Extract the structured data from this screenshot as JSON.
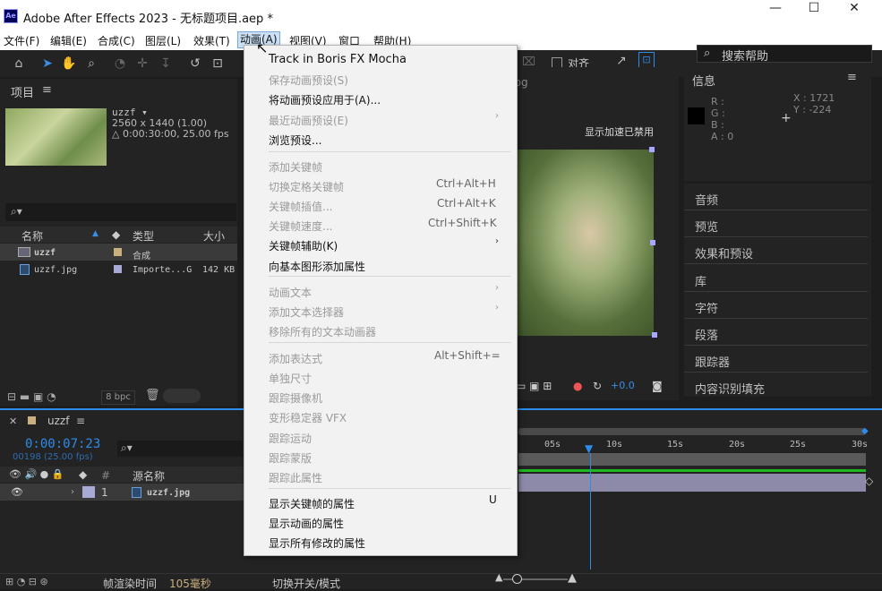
{
  "window": {
    "title": "Adobe After Effects 2023 - 无标题项目.aep *",
    "logo": "Ae",
    "minimize": "—",
    "maximize": "☐",
    "close": "✕"
  },
  "menubar": [
    "文件(F)",
    "编辑(E)",
    "合成(C)",
    "图层(L)",
    "效果(T)",
    "动画(A)",
    "视图(V)",
    "窗口",
    "帮助(H)"
  ],
  "toolbar": {
    "snap_label": "对齐",
    "search_placeholder": "搜索帮助"
  },
  "project_panel": {
    "title": "项目",
    "comp_name": "uzzf ▾",
    "comp_size": "2560 x 1440 (1.00)",
    "comp_duration": "△ 0:00:30:00, 25.00 fps",
    "columns": [
      "名称",
      "类型",
      "大小"
    ],
    "rows": [
      {
        "name": "uzzf",
        "type": "合成",
        "size": ""
      },
      {
        "name": "uzzf.jpg",
        "type": "Importe...G",
        "size": "142 KB"
      }
    ],
    "bpc": "8 bpc"
  },
  "comp_viewer": {
    "footage_label": "jpg",
    "status": "显示加速已禁用",
    "exposure": "+0.0"
  },
  "info_panel": {
    "title": "信息",
    "r": "R :",
    "g": "G :",
    "b": "B :",
    "a": "A : 0",
    "x": "X : 1721",
    "y": "Y : -224"
  },
  "right_panels": [
    "音频",
    "预览",
    "效果和预设",
    "库",
    "字符",
    "段落",
    "跟踪器",
    "内容识别填充"
  ],
  "anim_menu": {
    "items": [
      {
        "label": "Track in Boris FX Mocha",
        "enabled": true
      },
      {
        "label": "保存动画预设(S)",
        "enabled": false
      },
      {
        "label": "将动画预设应用于(A)...",
        "enabled": true
      },
      {
        "label": "最近动画预设(E)",
        "enabled": false,
        "submenu": true
      },
      {
        "label": "浏览预设...",
        "enabled": true
      },
      {
        "label": "添加关键帧",
        "enabled": false
      },
      {
        "label": "切换定格关键帧",
        "enabled": false,
        "shortcut": "Ctrl+Alt+H"
      },
      {
        "label": "关键帧插值...",
        "enabled": false,
        "shortcut": "Ctrl+Alt+K"
      },
      {
        "label": "关键帧速度...",
        "enabled": false,
        "shortcut": "Ctrl+Shift+K"
      },
      {
        "label": "关键帧辅助(K)",
        "enabled": true,
        "submenu": true
      },
      {
        "label": "向基本图形添加属性",
        "enabled": true
      },
      {
        "label": "动画文本",
        "enabled": false,
        "submenu": true
      },
      {
        "label": "添加文本选择器",
        "enabled": false,
        "submenu": true
      },
      {
        "label": "移除所有的文本动画器",
        "enabled": false
      },
      {
        "label": "添加表达式",
        "enabled": false,
        "shortcut": "Alt+Shift+="
      },
      {
        "label": "单独尺寸",
        "enabled": false
      },
      {
        "label": "跟踪摄像机",
        "enabled": false
      },
      {
        "label": "变形稳定器 VFX",
        "enabled": false
      },
      {
        "label": "跟踪运动",
        "enabled": false
      },
      {
        "label": "跟踪蒙版",
        "enabled": false
      },
      {
        "label": "跟踪此属性",
        "enabled": false
      },
      {
        "label": "显示关键帧的属性",
        "enabled": true,
        "shortcut": "U"
      },
      {
        "label": "显示动画的属性",
        "enabled": true
      },
      {
        "label": "显示所有修改的属性",
        "enabled": true
      }
    ]
  },
  "timeline": {
    "comp_tab": "uzzf",
    "timecode": "0:00:07:23",
    "frame_info": "00198 (25.00 fps)",
    "source_col": "源名称",
    "layer_num": "1",
    "layer_name": "uzzf.jpg",
    "ruler": [
      "05s",
      "10s",
      "15s",
      "20s",
      "25s",
      "30s"
    ],
    "render_label": "帧渲染时间",
    "render_value": "105毫秒",
    "switch_mode": "切换开关/模式"
  }
}
